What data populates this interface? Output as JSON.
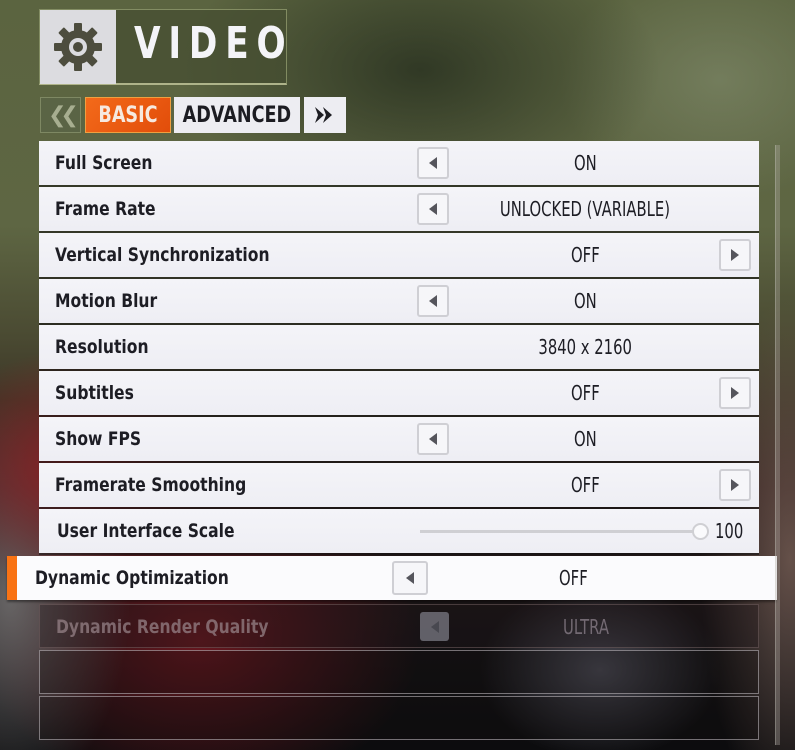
{
  "header": {
    "icon": "gear-icon",
    "title": "VIDEO"
  },
  "tabs": {
    "prev_icon": "double-chevron-left-icon",
    "next_icon": "double-chevron-right-icon",
    "items": [
      {
        "label": "BASIC",
        "active": true
      },
      {
        "label": "ADVANCED",
        "active": false
      }
    ]
  },
  "settings": [
    {
      "name": "Full Screen",
      "value": "ON",
      "control": "left-arrow"
    },
    {
      "name": "Frame Rate",
      "value": "UNLOCKED (VARIABLE)",
      "control": "left-arrow"
    },
    {
      "name": "Vertical Synchronization",
      "value": "OFF",
      "control": "right-arrow"
    },
    {
      "name": "Motion Blur",
      "value": "ON",
      "control": "left-arrow"
    },
    {
      "name": "Resolution",
      "value": "3840 x 2160",
      "control": "none"
    },
    {
      "name": "Subtitles",
      "value": "OFF",
      "control": "right-arrow"
    },
    {
      "name": "Show FPS",
      "value": "ON",
      "control": "left-arrow"
    },
    {
      "name": "Framerate Smoothing",
      "value": "OFF",
      "control": "right-arrow"
    },
    {
      "name": "User Interface Scale",
      "value": "100",
      "control": "slider",
      "slider_fraction": 1.0
    },
    {
      "name": "Dynamic Optimization",
      "value": "OFF",
      "control": "left-arrow",
      "selected": true
    },
    {
      "name": "Dynamic Render Quality",
      "value": "ULTRA",
      "control": "left-arrow",
      "disabled": true
    }
  ],
  "colors": {
    "accent": "#f97314",
    "tab_active": "#e85510",
    "row_bg": "#f2f2f6",
    "text_dark": "#1d1d24"
  }
}
